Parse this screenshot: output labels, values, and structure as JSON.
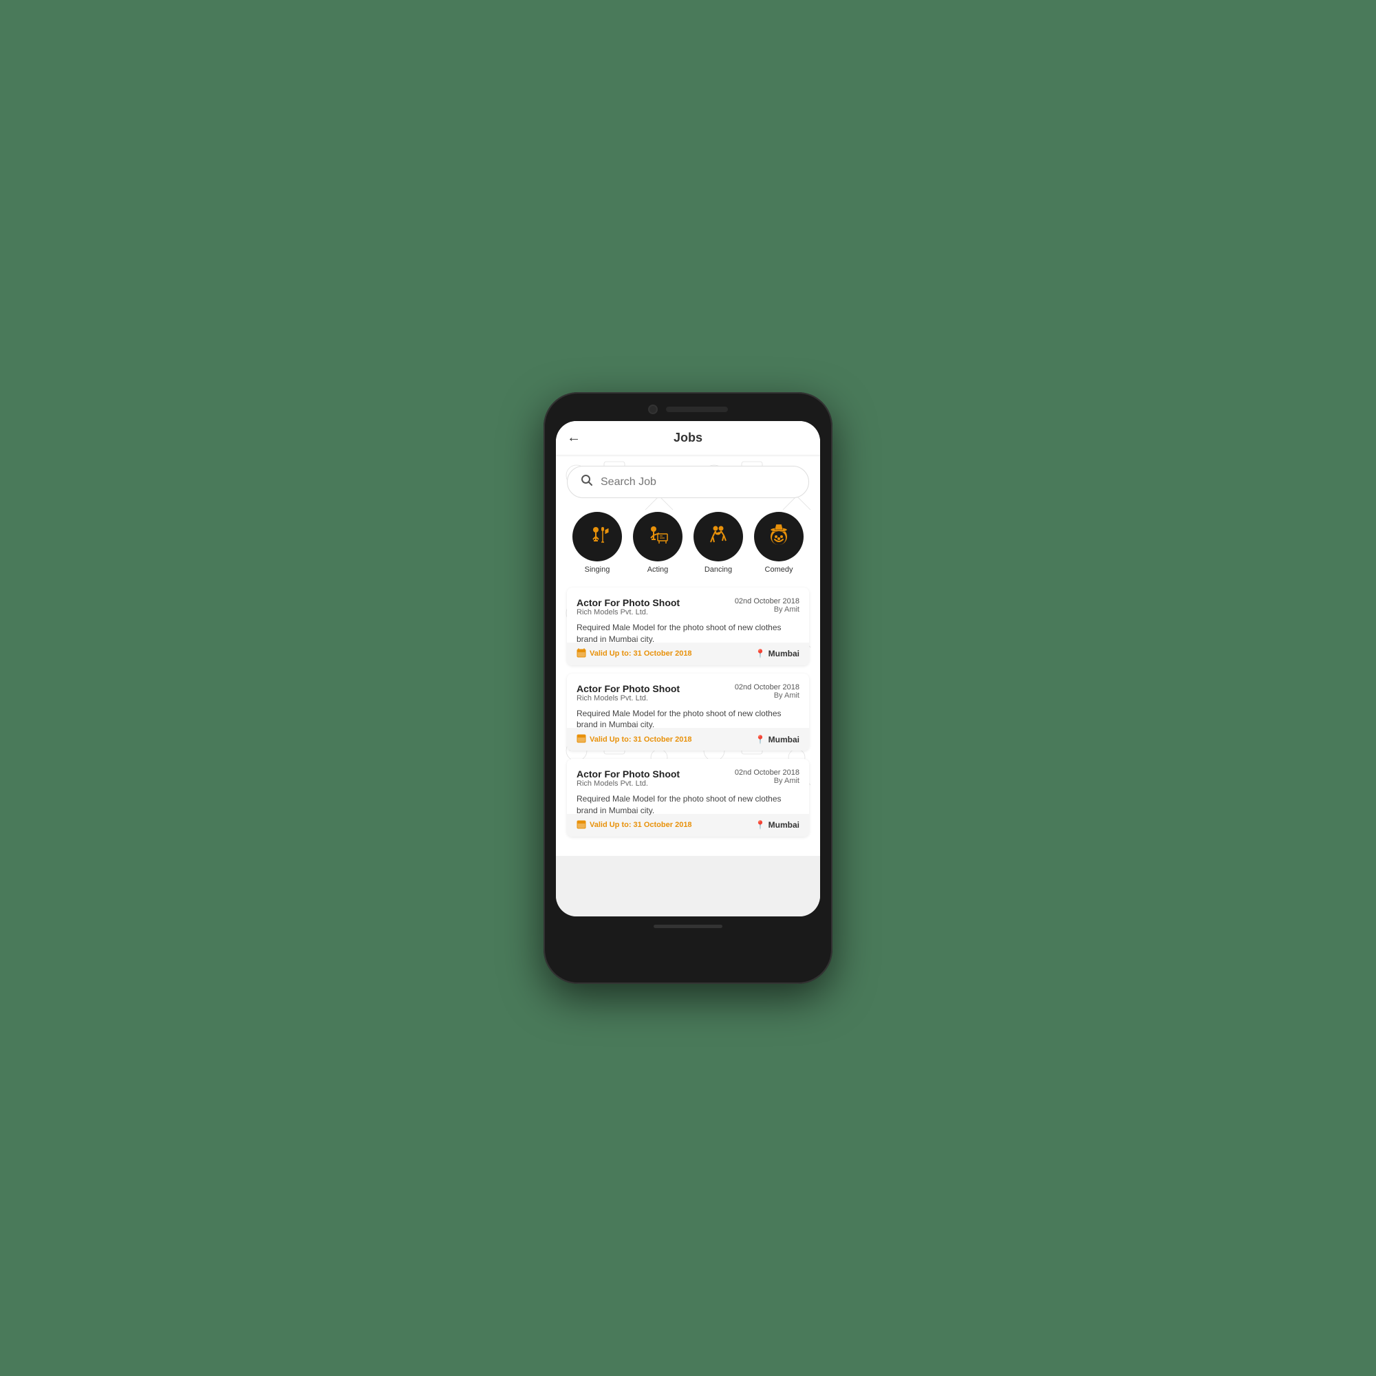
{
  "header": {
    "title": "Jobs",
    "back_icon": "←"
  },
  "search": {
    "placeholder": "Search Job"
  },
  "categories": [
    {
      "id": "singing",
      "label": "Singing"
    },
    {
      "id": "acting",
      "label": "Acting"
    },
    {
      "id": "dancing",
      "label": "Dancing"
    },
    {
      "id": "comedy",
      "label": "Comedy"
    }
  ],
  "jobs": [
    {
      "title": "Actor For Photo Shoot",
      "company": "Rich Models Pvt. Ltd.",
      "date": "02nd October 2018",
      "by": "By Amit",
      "description": "Required Male Model for the photo shoot of new clothes brand in Mumbai city.",
      "valid_until": "Valid Up to: 31 October 2018",
      "location": "Mumbai"
    },
    {
      "title": "Actor For Photo Shoot",
      "company": "Rich Models Pvt. Ltd.",
      "date": "02nd October 2018",
      "by": "By Amit",
      "description": "Required Male Model for the photo shoot of new clothes brand in Mumbai city.",
      "valid_until": "Valid Up to: 31 October 2018",
      "location": "Mumbai"
    },
    {
      "title": "Actor For Photo Shoot",
      "company": "Rich Models Pvt. Ltd.",
      "date": "02nd October 2018",
      "by": "By Amit",
      "description": "Required Male Model for the photo shoot of new clothes brand in Mumbai city.",
      "valid_until": "Valid Up to: 31 October 2018",
      "location": "Mumbai"
    }
  ],
  "colors": {
    "accent": "#e8910a",
    "dark": "#1a1a1a",
    "header_bg": "#ffffff"
  }
}
